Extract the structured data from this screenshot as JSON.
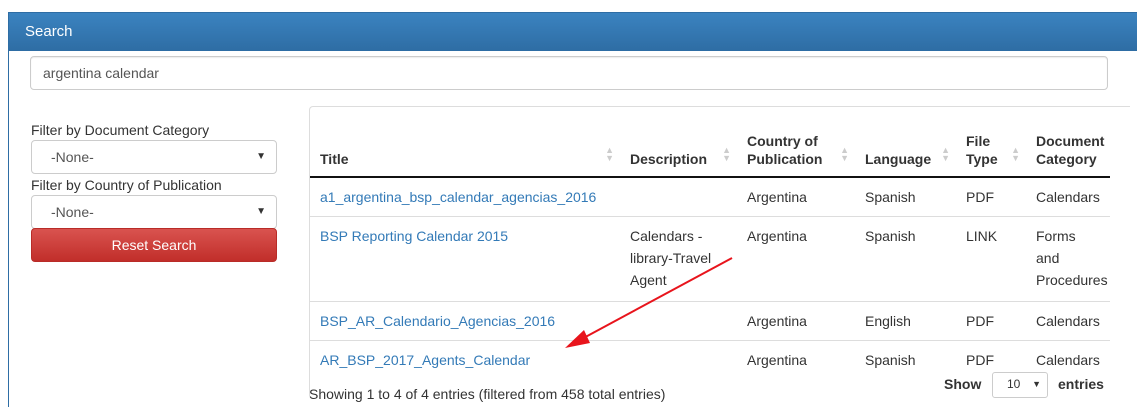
{
  "panel": {
    "title": "Search"
  },
  "search": {
    "value": "argentina calendar"
  },
  "filters": {
    "category_label": "Filter by Document Category",
    "category_value": "-None-",
    "country_label": "Filter by Country of Publication",
    "country_value": "-None-",
    "reset_label": "Reset Search"
  },
  "table": {
    "headers": [
      "Title",
      "Description",
      "Country of Publication",
      "Language",
      "File Type",
      "Document Category"
    ],
    "rows": [
      [
        "a1_argentina_bsp_calendar_agencias_2016",
        "",
        "Argentina",
        "Spanish",
        "PDF",
        "Calendars"
      ],
      [
        "BSP Reporting Calendar 2015",
        "Calendars - library-Travel Agent",
        "Argentina",
        "Spanish",
        "LINK",
        "Forms and Procedures"
      ],
      [
        "BSP_AR_Calendario_Agencias_2016",
        "",
        "Argentina",
        "English",
        "PDF",
        "Calendars"
      ],
      [
        "AR_BSP_2017_Agents_Calendar",
        "",
        "Argentina",
        "Spanish",
        "PDF",
        "Calendars"
      ]
    ]
  },
  "footer": {
    "info": "Showing 1 to 4 of 4 entries (filtered from 458 total entries)",
    "show_label": "Show",
    "length_value": "10",
    "entries_label": "entries"
  },
  "annotation": {
    "arrow_color": "#e8141c"
  },
  "colors": {
    "link": "#337ab7",
    "header": "#2e6da4",
    "danger": "#d9534f"
  }
}
